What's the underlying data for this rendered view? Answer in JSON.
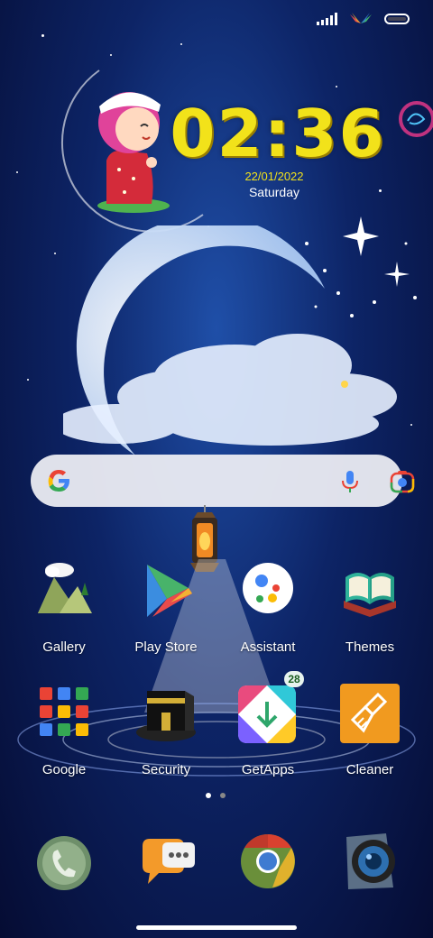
{
  "status_bar": {
    "signal_icon": "signal-bars-icon",
    "wing_icon": "wing-logo-icon",
    "battery_icon": "battery-icon"
  },
  "clock": {
    "time": "02:36",
    "date": "22/01/2022",
    "day": "Saturday"
  },
  "search": {
    "logo_icon": "google-g-icon",
    "mic_icon": "microphone-icon",
    "lens_icon": "google-lens-icon"
  },
  "apps_row1": [
    {
      "label": "Gallery",
      "icon": "gallery-icon"
    },
    {
      "label": "Play Store",
      "icon": "play-store-icon"
    },
    {
      "label": "Assistant",
      "icon": "assistant-icon"
    },
    {
      "label": "Themes",
      "icon": "quran-themes-icon"
    }
  ],
  "apps_row2": [
    {
      "label": "Google",
      "icon": "google-folder-icon"
    },
    {
      "label": "Security",
      "icon": "kaaba-security-icon"
    },
    {
      "label": "GetApps",
      "icon": "getapps-icon",
      "badge": "28"
    },
    {
      "label": "Cleaner",
      "icon": "broom-cleaner-icon"
    }
  ],
  "page_indicator": {
    "pages": 2,
    "active": 1
  },
  "dock": [
    {
      "icon": "phone-icon"
    },
    {
      "icon": "messages-icon"
    },
    {
      "icon": "chrome-icon"
    },
    {
      "icon": "camera-icon"
    }
  ],
  "colors": {
    "clock_yellow": "#f2e21a",
    "background_blue": "#0d2466",
    "cleaner_orange": "#f19a1f"
  }
}
